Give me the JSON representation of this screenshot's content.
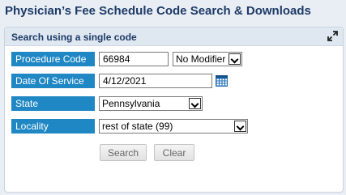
{
  "page": {
    "title": "Physician’s Fee Schedule Code Search & Downloads"
  },
  "panel": {
    "title": "Search using a single code",
    "expand_icon": "expand-arrows-icon"
  },
  "form": {
    "procedure_code": {
      "label": "Procedure Code",
      "value": "66984"
    },
    "modifier": {
      "selected": "No Modifier"
    },
    "date_of_service": {
      "label": "Date Of Service",
      "value": "4/12/2021",
      "icon": "calendar-icon"
    },
    "state": {
      "label": "State",
      "selected": "Pennsylvania"
    },
    "locality": {
      "label": "Locality",
      "selected": "rest of state (99)"
    }
  },
  "buttons": {
    "search": "Search",
    "clear": "Clear"
  },
  "colors": {
    "label_bg": "#1f87c4",
    "title": "#1d3a66",
    "calendar": "#1f6db4"
  }
}
